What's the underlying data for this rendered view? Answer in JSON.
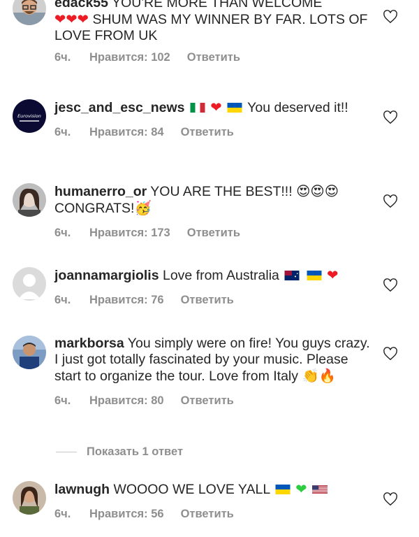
{
  "comments": [
    {
      "username": "edack55",
      "text": "YOU'RE MORE THAN WELCOME",
      "text2": "SHUM WAS MY WINNER BY FAR. LOTS OF LOVE FROM UK",
      "time": "6ч.",
      "likes": "Нравится: 102",
      "reply": "Ответить"
    },
    {
      "username": "jesc_and_esc_news",
      "text": "You deserved it!!",
      "avatar_text": "Eurovision",
      "time": "6ч.",
      "likes": "Нравится: 84",
      "reply": "Ответить"
    },
    {
      "username": "humanerro_or",
      "text": "YOU ARE THE BEST!!!",
      "text2": "CONGRATS!",
      "time": "6ч.",
      "likes": "Нравится: 173",
      "reply": "Ответить"
    },
    {
      "username": "joannamargiolis",
      "text": "Love from Australia",
      "time": "6ч.",
      "likes": "Нравится: 76",
      "reply": "Ответить"
    },
    {
      "username": "markborsa",
      "text": "You simply were on fire! You guys crazy. I just got totally fascinated by your music. Please start to organize the tour. Love from Italy",
      "time": "6ч.",
      "likes": "Нравится: 80",
      "reply": "Ответить"
    },
    {
      "username": "lawnugh",
      "text": "WOOOO WE LOVE YALL",
      "time": "6ч.",
      "likes": "Нравится: 56",
      "reply": "Ответить"
    }
  ],
  "show_replies": "Показать 1 ответ",
  "colors": {
    "heart_red": "#ed1c24",
    "meta_gray": "#8e8e8e",
    "text": "#262626"
  },
  "icons": [
    "heart-outline-icon",
    "red-heart-emoji",
    "green-heart-emoji",
    "heart-eyes-emoji",
    "party-face-emoji",
    "clapping-hands-emoji",
    "fire-emoji",
    "italy-flag",
    "ukraine-flag",
    "australia-flag",
    "usa-flag"
  ]
}
